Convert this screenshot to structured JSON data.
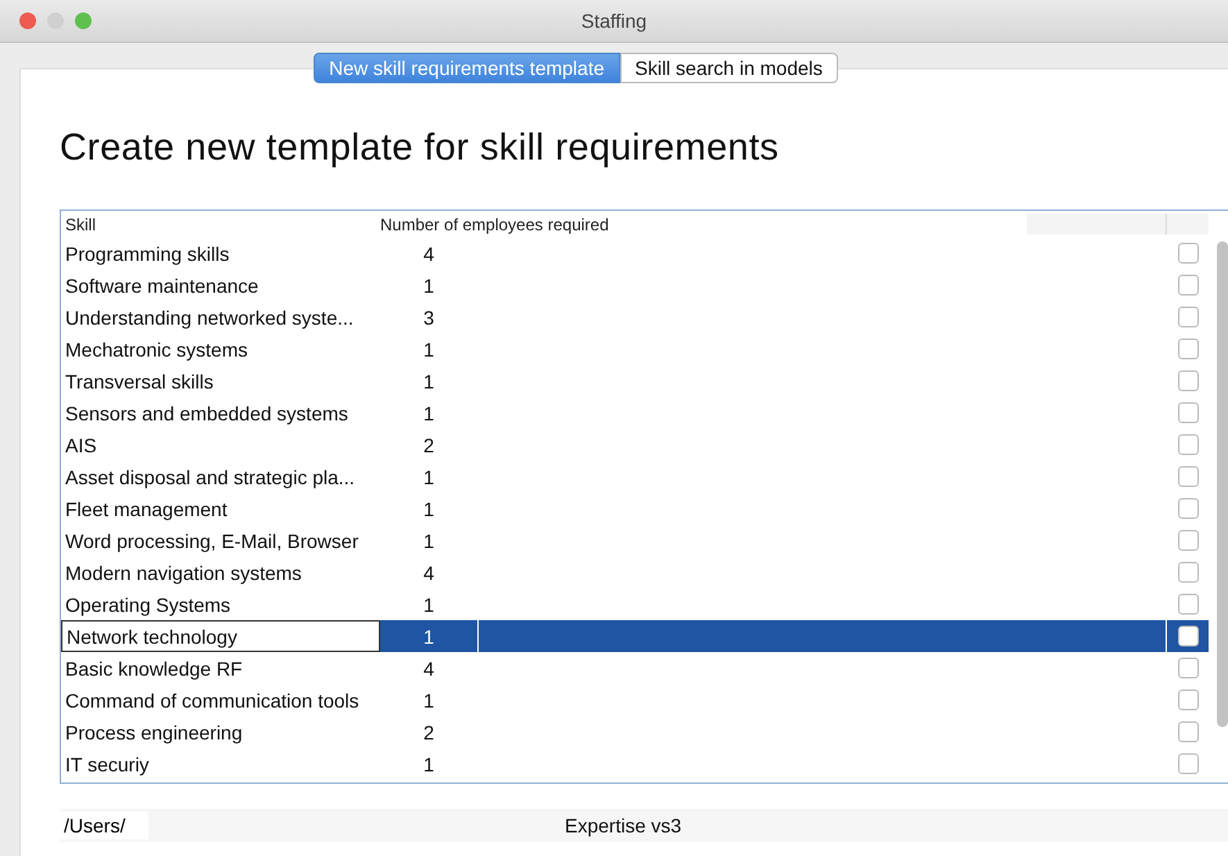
{
  "window": {
    "title": "Staffing"
  },
  "tabs": [
    {
      "label": "New skill requirements template",
      "selected": true
    },
    {
      "label": "Skill search in models",
      "selected": false
    }
  ],
  "heading": "Create new template for skill requirements",
  "table": {
    "columns": [
      "Skill",
      "Number of employees required"
    ],
    "rows": [
      {
        "skill": "Programming skills",
        "count": "4",
        "checked": false,
        "selected": false
      },
      {
        "skill": "Software maintenance",
        "count": "1",
        "checked": false,
        "selected": false
      },
      {
        "skill": "Understanding networked syste...",
        "count": "3",
        "checked": false,
        "selected": false
      },
      {
        "skill": "Mechatronic systems",
        "count": "1",
        "checked": false,
        "selected": false
      },
      {
        "skill": "Transversal skills",
        "count": "1",
        "checked": false,
        "selected": false
      },
      {
        "skill": "Sensors and embedded systems",
        "count": "1",
        "checked": false,
        "selected": false
      },
      {
        "skill": "AIS",
        "count": "2",
        "checked": false,
        "selected": false
      },
      {
        "skill": "Asset disposal and strategic pla...",
        "count": "1",
        "checked": false,
        "selected": false
      },
      {
        "skill": "Fleet management",
        "count": "1",
        "checked": false,
        "selected": false
      },
      {
        "skill": "Word processing, E-Mail, Browser",
        "count": "1",
        "checked": false,
        "selected": false
      },
      {
        "skill": "Modern navigation systems",
        "count": "4",
        "checked": false,
        "selected": false
      },
      {
        "skill": "Operating Systems",
        "count": "1",
        "checked": false,
        "selected": false
      },
      {
        "skill": "Network technology",
        "count": "1",
        "checked": false,
        "selected": true
      },
      {
        "skill": "Basic knowledge RF",
        "count": "4",
        "checked": false,
        "selected": false
      },
      {
        "skill": "Command of communication tools",
        "count": "1",
        "checked": false,
        "selected": false
      },
      {
        "skill": "Process engineering",
        "count": "2",
        "checked": false,
        "selected": false
      },
      {
        "skill": "IT securiy",
        "count": "1",
        "checked": false,
        "selected": false
      }
    ]
  },
  "footer": {
    "path": "/Users/",
    "name": "Expertise vs3"
  }
}
